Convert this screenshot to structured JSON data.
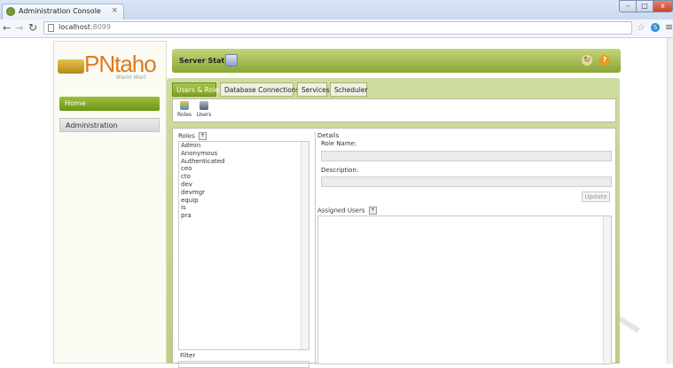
{
  "browser": {
    "tab_title": "Administration Console",
    "tab_close": "×",
    "url_host": "localhost",
    "url_port": ":8099",
    "win_min": "–",
    "win_max": "□",
    "win_close": "x"
  },
  "app": {
    "logo_text": "PNtaho",
    "logo_tagline": "Warm Worl",
    "nav": {
      "home": "Home",
      "administration": "Administration"
    },
    "status_label": "Server Status:",
    "refresh_glyph": "↻",
    "help_glyph": "?"
  },
  "tabs": [
    {
      "label": "Users & Roles",
      "active": true
    },
    {
      "label": "Database Connections",
      "active": false
    },
    {
      "label": "Services",
      "active": false
    },
    {
      "label": "Scheduler",
      "active": false
    }
  ],
  "toolbar": {
    "roles": "Roles",
    "users": "Users"
  },
  "roles": {
    "header": "Roles",
    "plus": "+",
    "items": [
      "Admin",
      "Anonymous",
      "Authenticated",
      "ceo",
      "cto",
      "dev",
      "devmgr",
      "equip",
      "is",
      "pra"
    ],
    "filter_label": "Filter"
  },
  "details": {
    "title": "Details",
    "role_name_label": "Role Name:",
    "description_label": "Description:",
    "update_button": "Update",
    "assigned_users_label": "Assigned Users"
  },
  "colors": {
    "accent_green": "#7ea126",
    "logo_orange": "#e07a1e"
  }
}
